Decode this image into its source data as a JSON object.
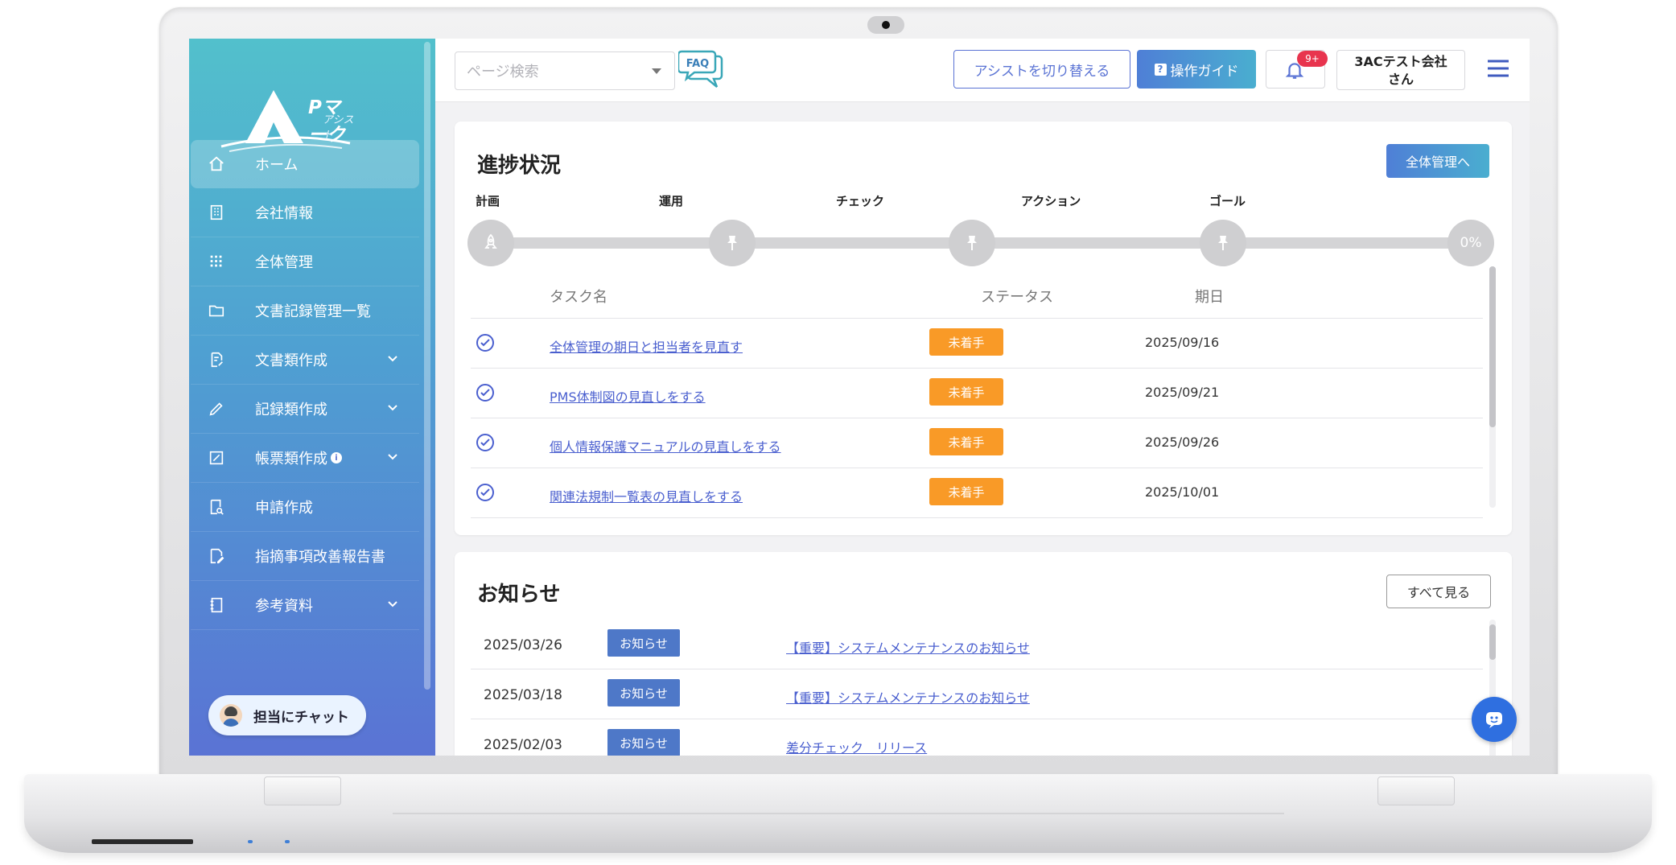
{
  "app": {
    "logo_title": "Pマーク",
    "logo_sub": "アシスト"
  },
  "sidebar": {
    "items": [
      {
        "label": "ホーム",
        "icon": "home-icon",
        "active": true
      },
      {
        "label": "会社情報",
        "icon": "building-icon"
      },
      {
        "label": "全体管理",
        "icon": "grid-icon"
      },
      {
        "label": "文書記録管理一覧",
        "icon": "folder-icon"
      },
      {
        "label": "文書類作成",
        "icon": "document-edit-icon",
        "expandable": true
      },
      {
        "label": "記録類作成",
        "icon": "pencil-icon",
        "expandable": true
      },
      {
        "label": "帳票類作成",
        "icon": "form-icon",
        "expandable": true,
        "info": "i"
      },
      {
        "label": "申請作成",
        "icon": "application-icon"
      },
      {
        "label": "指摘事項改善報告書",
        "icon": "report-icon"
      },
      {
        "label": "参考資料",
        "icon": "book-icon",
        "expandable": true
      }
    ],
    "chat_button": "担当にチャット"
  },
  "header": {
    "search_placeholder": "ページ検索",
    "faq_label": "FAQ",
    "switch_assist": "アシストを切り替える",
    "guide_label": "操作ガイド",
    "guide_badge": "?",
    "notification_count": "9+",
    "company_line1": "3ACテスト会社",
    "company_line2": "さん"
  },
  "progress": {
    "title": "進捗状況",
    "manage_button": "全体管理へ",
    "stages": [
      "計画",
      "運用",
      "チェック",
      "アクション",
      "ゴール"
    ],
    "goal_percent": "0%",
    "columns": {
      "task": "タスク名",
      "status": "ステータス",
      "due": "期日"
    },
    "tasks": [
      {
        "name": "全体管理の期日と担当者を見直す",
        "status": "未着手",
        "due": "2025/09/16"
      },
      {
        "name": "PMS体制図の見直しをする",
        "status": "未着手",
        "due": "2025/09/21"
      },
      {
        "name": "個人情報保護マニュアルの見直しをする",
        "status": "未着手",
        "due": "2025/09/26"
      },
      {
        "name": "関連法規制一覧表の見直しをする",
        "status": "未着手",
        "due": "2025/10/01"
      }
    ]
  },
  "news": {
    "title": "お知らせ",
    "view_all": "すべて見る",
    "items": [
      {
        "date": "2025/03/26",
        "tag": "お知らせ",
        "title": "【重要】システムメンテナンスのお知らせ"
      },
      {
        "date": "2025/03/18",
        "tag": "お知らせ",
        "title": "【重要】システムメンテナンスのお知らせ"
      },
      {
        "date": "2025/02/03",
        "tag": "お知らせ",
        "title": "差分チェック　リリース"
      }
    ]
  },
  "colors": {
    "accent": "#5a73d4",
    "status_orange": "#f99a27",
    "tag_blue": "#4e78c8",
    "link": "#4a5fcf"
  }
}
